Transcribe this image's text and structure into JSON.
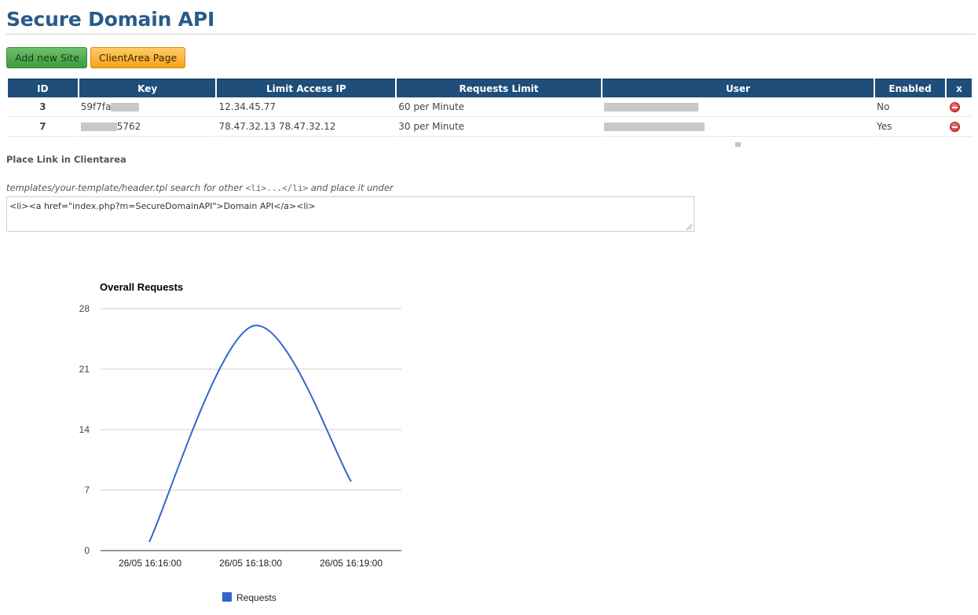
{
  "page": {
    "title": "Secure Domain API"
  },
  "toolbar": {
    "add_site_label": "Add new Site",
    "clientarea_label": "ClientArea Page"
  },
  "table": {
    "headers": [
      "ID",
      "Key",
      "Limit Access IP",
      "Requests Limit",
      "User",
      "Enabled",
      "x"
    ],
    "rows": [
      {
        "id": "3",
        "key_visible": "59f7fa",
        "key_suffix": "",
        "ip": "12.34.45.77",
        "limit": "60 per Minute",
        "enabled": "No"
      },
      {
        "id": "7",
        "key_visible": "",
        "key_suffix": "5762",
        "ip": "78.47.32.13 78.47.32.12",
        "limit": "30 per Minute",
        "enabled": "Yes"
      }
    ]
  },
  "clientarea": {
    "heading": "Place Link in Clientarea",
    "instruction_pre": "templates/your-template/header.tpl search for other ",
    "instruction_code": "<li>...</li>",
    "instruction_post": " and place it under",
    "snippet": "<li><a href=\"index.php?m=SecureDomainAPI\">Domain API</a><li>"
  },
  "colors": {
    "header_bg": "#1f4e7a",
    "title": "#2a5a8a",
    "series": "#3366cc",
    "enabled_no": "#b00000",
    "enabled_yes": "#2a7a1a"
  },
  "chart_data": {
    "type": "line",
    "title": "Overall Requests",
    "categories": [
      "26/05 16:16:00",
      "26/05 16:18:00",
      "26/05 16:19:00"
    ],
    "series": [
      {
        "name": "Requests",
        "values": [
          1,
          26,
          8
        ]
      }
    ],
    "ylim": [
      0,
      28
    ],
    "yticks": [
      0,
      7,
      14,
      21,
      28
    ],
    "grid": true,
    "smooth": true,
    "legend": "bottom"
  }
}
